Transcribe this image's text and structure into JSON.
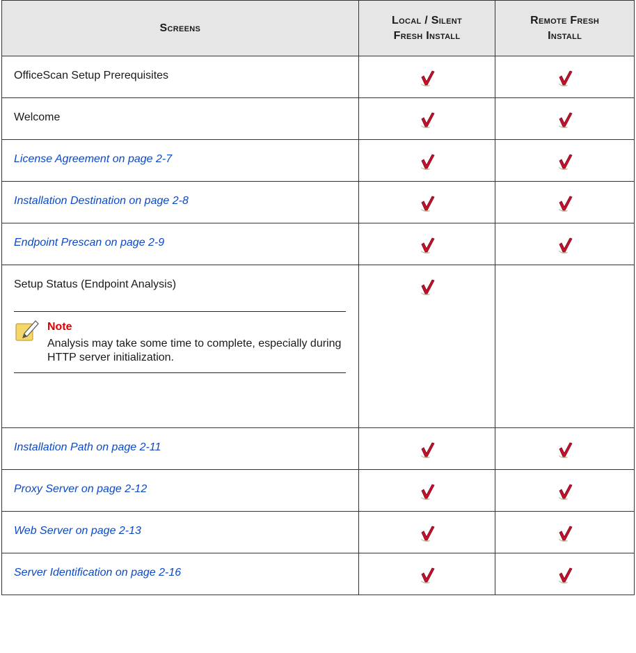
{
  "header": {
    "col1": "Screens",
    "col2_line1": "Local / Silent",
    "col2_line2": "Fresh Install",
    "col3_line1": "Remote Fresh",
    "col3_line2": "Install"
  },
  "rows": [
    {
      "label": "OfficeScan Setup Prerequisites",
      "is_link": false,
      "local": true,
      "remote": true
    },
    {
      "label": "Welcome",
      "is_link": false,
      "local": true,
      "remote": true
    },
    {
      "label": "License Agreement on page 2-7",
      "is_link": true,
      "local": true,
      "remote": true
    },
    {
      "label": "Installation Destination on page 2-8",
      "is_link": true,
      "local": true,
      "remote": true
    },
    {
      "label": "Endpoint Prescan on page 2-9",
      "is_link": true,
      "local": true,
      "remote": true
    },
    {
      "label": "Setup Status (Endpoint Analysis)",
      "is_link": false,
      "local": true,
      "remote": false
    },
    {
      "label": "Installation Path on page 2-11",
      "is_link": true,
      "local": true,
      "remote": true
    },
    {
      "label": "Proxy Server on page 2-12",
      "is_link": true,
      "local": true,
      "remote": true
    },
    {
      "label": "Web Server on page 2-13",
      "is_link": true,
      "local": true,
      "remote": true
    },
    {
      "label": "Server Identification on page 2-16",
      "is_link": true,
      "local": true,
      "remote": true
    }
  ],
  "note": {
    "title": "Note",
    "body": "Analysis may take some time to complete, especially during HTTP server initialization."
  },
  "colors": {
    "link": "#0b49c9",
    "note_title": "#e00000",
    "check": "#c8102e",
    "header_bg": "#e6e6e6"
  },
  "icons": {
    "check": "checkmark-icon",
    "note": "note-pencil-icon"
  }
}
